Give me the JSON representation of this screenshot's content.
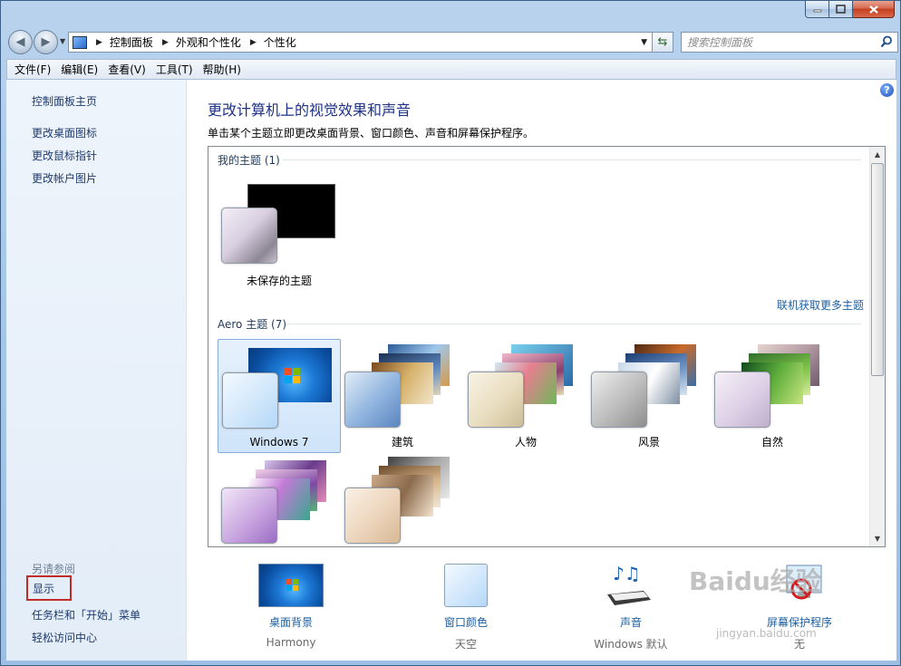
{
  "nav": {
    "breadcrumb": [
      "控制面板",
      "外观和个性化",
      "个性化"
    ],
    "search_placeholder": "搜索控制面板"
  },
  "menu": [
    "文件(F)",
    "编辑(E)",
    "查看(V)",
    "工具(T)",
    "帮助(H)"
  ],
  "sidebar": {
    "home": "控制面板主页",
    "links": [
      "更改桌面图标",
      "更改鼠标指针",
      "更改帐户图片"
    ],
    "see_also": "另请参阅",
    "see_also_links": [
      "显示",
      "任务栏和「开始」菜单",
      "轻松访问中心"
    ]
  },
  "main": {
    "title": "更改计算机上的视觉效果和声音",
    "subtitle": "单击某个主题立即更改桌面背景、窗口颜色、声音和屏幕保护程序。",
    "my_themes_header": "我的主题 (1)",
    "unsaved_theme": "未保存的主题",
    "online_link": "联机获取更多主题",
    "aero_header": "Aero 主题 (7)",
    "aero_themes": [
      "Windows 7",
      "建筑",
      "人物",
      "风景",
      "自然"
    ],
    "selected_theme": "Windows 7"
  },
  "settings": [
    {
      "label": "桌面背景",
      "value": "Harmony"
    },
    {
      "label": "窗口颜色",
      "value": "天空"
    },
    {
      "label": "声音",
      "value": "Windows 默认"
    },
    {
      "label": "屏幕保护程序",
      "value": "无"
    }
  ],
  "watermark": {
    "brand": "Baidu经验",
    "url": "jingyan.baidu.com"
  },
  "colors": {
    "link": "#1e5fa0",
    "title": "#1e3287",
    "highlight_border": "#c32b2b",
    "selection": "#cfe4fa"
  }
}
